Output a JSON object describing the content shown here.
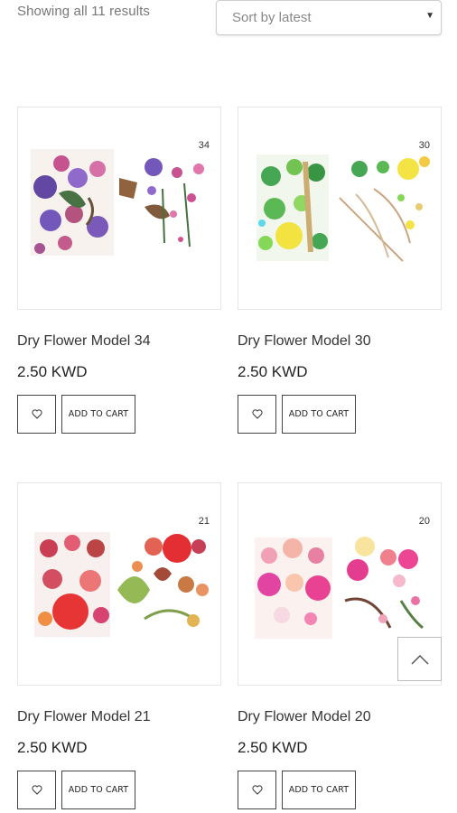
{
  "shop": {
    "result_count": "Showing all 11 results",
    "sort": {
      "selected": "Sort by latest"
    }
  },
  "products": [
    {
      "model_number": "34",
      "title": "Dry Flower Model 34",
      "price": "2.50 KWD",
      "add_to_cart": "ADD TO CART"
    },
    {
      "model_number": "30",
      "title": "Dry Flower Model 30",
      "price": "2.50 KWD",
      "add_to_cart": "ADD TO CART"
    },
    {
      "model_number": "21",
      "title": "Dry Flower Model 21",
      "price": "2.50 KWD",
      "add_to_cart": "ADD TO CART"
    },
    {
      "model_number": "20",
      "title": "Dry Flower Model 20",
      "price": "2.50 KWD",
      "add_to_cart": "ADD TO CART"
    }
  ],
  "icons": {
    "wishlist": "heart-icon",
    "sort": "chevron-down-icon",
    "scroll_top": "chevron-up-icon"
  }
}
